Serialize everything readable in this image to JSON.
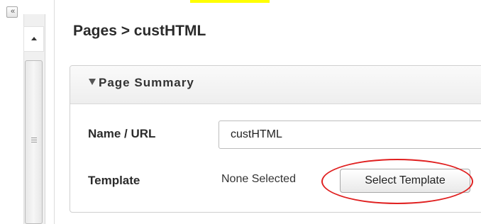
{
  "sidebar": {
    "collapse_label": "«"
  },
  "header": {
    "title": "Pages > custHTML"
  },
  "panel": {
    "title": "Page Summary",
    "fields": {
      "name_label": "Name / URL",
      "name_value": "custHTML",
      "template_label": "Template",
      "template_value": "None Selected",
      "select_template_label": "Select Template"
    }
  },
  "colors": {
    "highlight": "#ffff00",
    "annotation_circle": "#e02020"
  },
  "icons": {
    "collapse": "double-chevron-left-icon",
    "scroll_up": "triangle-up-icon",
    "section_toggle": "triangle-down-icon"
  }
}
